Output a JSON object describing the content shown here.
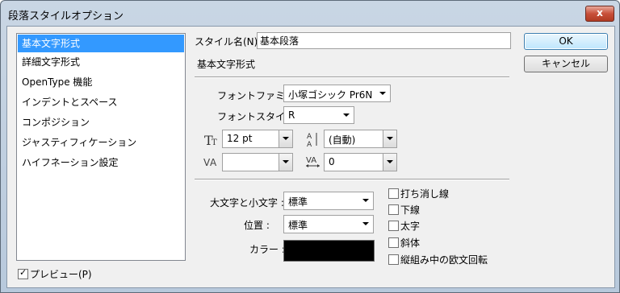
{
  "window": {
    "title": "段落スタイルオプション",
    "close_glyph": "x"
  },
  "sidebar": {
    "items": [
      {
        "label": "基本文字形式",
        "selected": true
      },
      {
        "label": "詳細文字形式",
        "selected": false
      },
      {
        "label": "OpenType 機能",
        "selected": false
      },
      {
        "label": "インデントとスペース",
        "selected": false
      },
      {
        "label": "コンポジション",
        "selected": false
      },
      {
        "label": "ジャスティフィケーション",
        "selected": false
      },
      {
        "label": "ハイフネーション設定",
        "selected": false
      }
    ],
    "preview": {
      "label": "プレビュー(P)",
      "checked": true
    }
  },
  "header": {
    "style_name_label": "スタイル名(N) :",
    "style_name_value": "基本段落",
    "section_title": "基本文字形式"
  },
  "buttons": {
    "ok": "OK",
    "cancel": "キャンセル"
  },
  "font": {
    "family_label": "フォントファミリー :",
    "family_value": "小塚ゴシック Pr6N",
    "style_label": "フォントスタイル :",
    "style_value": "R"
  },
  "metrics": {
    "size_value": "12 pt",
    "leading_value": "(自動)",
    "kerning_value": "",
    "tracking_value": "0",
    "size_icon": "font-size-icon",
    "leading_icon": "leading-icon",
    "kerning_icon": "kerning-icon",
    "tracking_icon": "tracking-icon"
  },
  "case": {
    "case_label": "大文字と小文字 :",
    "case_value": "標準",
    "position_label": "位置 :",
    "position_value": "標準",
    "color_label": "カラー :",
    "color_hex": "#000000"
  },
  "options": [
    {
      "label": "打ち消し線",
      "checked": false
    },
    {
      "label": "下線",
      "checked": false
    },
    {
      "label": "太字",
      "checked": false
    },
    {
      "label": "斜体",
      "checked": false
    },
    {
      "label": "縦組み中の欧文回転",
      "checked": false
    }
  ]
}
